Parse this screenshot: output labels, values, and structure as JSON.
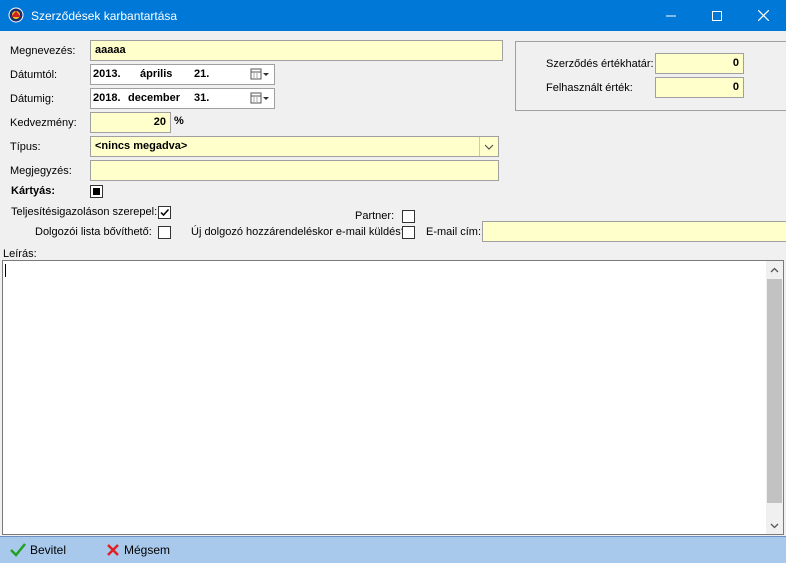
{
  "window": {
    "title": "Szerződések karbantartása",
    "icons": [
      "app-icon",
      "minimize-icon",
      "maximize-icon",
      "close-icon"
    ]
  },
  "form": {
    "megnevezes_label": "Megnevezés:",
    "megnevezes_value": "aaaaa",
    "datumtol_label": "Dátumtól:",
    "datumtol_year": "2013.",
    "datumtol_month": "április",
    "datumtol_day": "21.",
    "datumig_label": "Dátumig:",
    "datumig_year": "2018.",
    "datumig_month": "december",
    "datumig_day": "31.",
    "kedvezmeny_label": "Kedvezmény:",
    "kedvezmeny_value": "20",
    "kedvezmeny_unit": "%",
    "tipus_label": "Típus:",
    "tipus_value": "<nincs megadva>",
    "megjegyzes_label": "Megjegyzés:",
    "megjegyzes_value": "",
    "kartyas_label": "Kártyás:",
    "teljesites_label": "Teljesítésigazoláson szerepel:",
    "teljesites_checked": true,
    "partner_label": "Partner:",
    "partner_checked": false,
    "dolgozoi_label": "Dolgozói lista bővíthető:",
    "dolgozoi_checked": false,
    "uj_dolgozo_label": "Új dolgozó hozzárendeléskor e-mail küldés?",
    "uj_dolgozo_checked": false,
    "email_label": "E-mail cím:",
    "email_value": "",
    "leiras_label": "Leírás:",
    "leiras_value": ""
  },
  "values_box": {
    "ertekhatar_label": "Szerződés értékhatár:",
    "ertekhatar_value": "0",
    "felhasznalt_label": "Felhasznált érték:",
    "felhasznalt_value": "0"
  },
  "bottombar": {
    "bevitel_label": "Bevitel",
    "megsem_label": "Mégsem"
  },
  "colors": {
    "titlebar": "#0078d7",
    "field_bg": "#ffffcc",
    "bottombar": "#a9c9ec",
    "ok_green": "#22a022",
    "cancel_red": "#e02020"
  }
}
